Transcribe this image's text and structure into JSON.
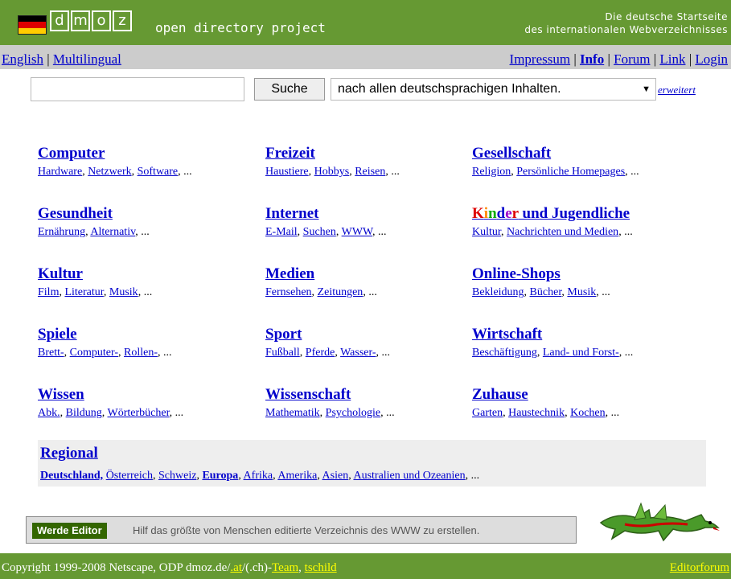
{
  "header": {
    "logo_letters": [
      "d",
      "m",
      "o",
      "z"
    ],
    "logo_text": "open directory project",
    "tagline_line1": "Die deutsche Startseite",
    "tagline_line2": "des internationalen Webverzeichnisses",
    "flag_colors": [
      "#000000",
      "#dd0000",
      "#ffcc00"
    ],
    "bar_color": "#669933"
  },
  "nav": {
    "left": [
      "English",
      "Multilingual"
    ],
    "right": [
      "Impressum",
      "Info",
      "Forum",
      "Link",
      "Login"
    ]
  },
  "search": {
    "input_value": "",
    "button_label": "Suche",
    "select_value": "nach allen deutschsprachigen Inhalten.",
    "advanced_label": "erweitert"
  },
  "categories": [
    {
      "title": "Computer",
      "subs": [
        "Hardware",
        "Netzwerk",
        "Software"
      ]
    },
    {
      "title": "Freizeit",
      "subs": [
        "Haustiere",
        "Hobbys",
        "Reisen"
      ]
    },
    {
      "title": "Gesellschaft",
      "subs": [
        "Religion",
        "Persönliche Homepages"
      ]
    },
    {
      "title": "Gesundheit",
      "subs": [
        "Ernährung",
        "Alternativ"
      ]
    },
    {
      "title": "Internet",
      "subs": [
        "E-Mail",
        "Suchen",
        "WWW"
      ]
    },
    {
      "title": "Kinder und Jugendliche",
      "subs": [
        "Kultur",
        "Nachrichten und Medien"
      ]
    },
    {
      "title": "Kultur",
      "subs": [
        "Film",
        "Literatur",
        "Musik"
      ]
    },
    {
      "title": "Medien",
      "subs": [
        "Fernsehen",
        "Zeitungen"
      ]
    },
    {
      "title": "Online-Shops",
      "subs": [
        "Bekleidung",
        "Bücher",
        "Musik"
      ]
    },
    {
      "title": "Spiele",
      "subs": [
        "Brett-",
        "Computer-",
        "Rollen-"
      ]
    },
    {
      "title": "Sport",
      "subs": [
        "Fußball",
        "Pferde",
        "Wasser-"
      ]
    },
    {
      "title": "Wirtschaft",
      "subs": [
        "Beschäftigung",
        "Land- und Forst-"
      ]
    },
    {
      "title": "Wissen",
      "subs": [
        "Abk.",
        "Bildung",
        "Wörterbücher"
      ]
    },
    {
      "title": "Wissenschaft",
      "subs": [
        "Mathematik",
        "Psychologie"
      ]
    },
    {
      "title": "Zuhause",
      "subs": [
        "Garten",
        "Haustechnik",
        "Kochen"
      ]
    }
  ],
  "kinder_letter_colors": [
    "#dd0000",
    "#ff8800",
    "#00aa00",
    "#0000cc",
    "#9900cc"
  ],
  "regional": {
    "title": "Regional",
    "subs": [
      {
        "label": "Deutschland,",
        "bold": true
      },
      {
        "label": "Österreich",
        "bold": false
      },
      {
        "label": "Schweiz",
        "bold": false
      },
      {
        "label": "Europa",
        "bold": true
      },
      {
        "label": "Afrika",
        "bold": false
      },
      {
        "label": "Amerika",
        "bold": false
      },
      {
        "label": "Asien",
        "bold": false
      },
      {
        "label": "Australien und Ozeanien",
        "bold": false
      }
    ]
  },
  "editor": {
    "button_label": "Werde Editor",
    "text": "Hilf das größte von Menschen editierte Verzeichnis des WWW zu erstellen."
  },
  "footer": {
    "copyright_prefix": "Copyright 1999-2008 Netscape, ODP dmoz.de/",
    "at_link": ".at",
    "ch_text": "/(.ch)-",
    "team_link": "Team",
    "tschild_link": "tschild",
    "editorforum_link": "Editorforum"
  }
}
